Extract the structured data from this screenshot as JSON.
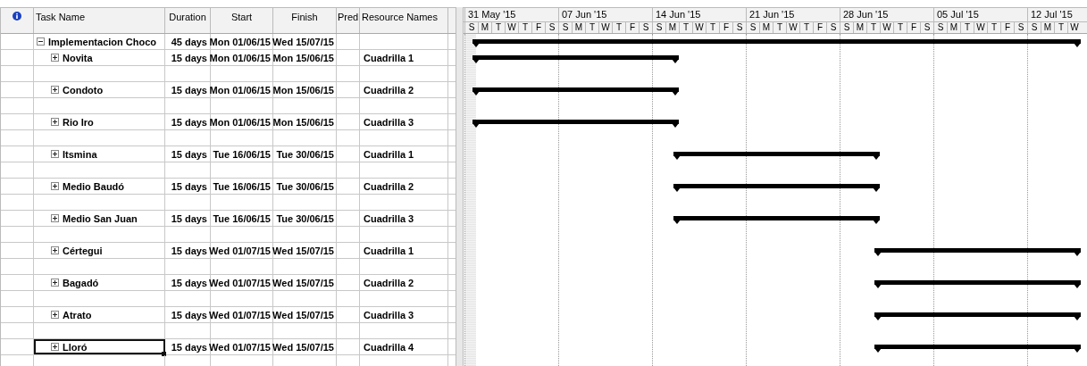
{
  "table": {
    "columns": [
      "Task Name",
      "Duration",
      "Start",
      "Finish",
      "Pred",
      "Resource Names"
    ],
    "summary": {
      "name": "Implementacion Choco",
      "duration": "45 days",
      "start": "Mon 01/06/15",
      "finish": "Wed 15/07/15",
      "expanded": true,
      "selected": false,
      "children": [
        {
          "name": "Novita",
          "duration": "15 days",
          "start": "Mon 01/06/15",
          "finish": "Mon 15/06/15",
          "resource": "Cuadrilla 1",
          "expanded": false,
          "selected": false
        },
        {
          "name": "Condoto",
          "duration": "15 days",
          "start": "Mon 01/06/15",
          "finish": "Mon 15/06/15",
          "resource": "Cuadrilla 2",
          "expanded": false,
          "selected": false
        },
        {
          "name": "Rio Iro",
          "duration": "15 days",
          "start": "Mon 01/06/15",
          "finish": "Mon 15/06/15",
          "resource": "Cuadrilla 3",
          "expanded": false,
          "selected": false
        },
        {
          "name": "Itsmina",
          "duration": "15 days",
          "start": "Tue 16/06/15",
          "finish": "Tue 30/06/15",
          "resource": "Cuadrilla 1",
          "expanded": false,
          "selected": false
        },
        {
          "name": "Medio Baudó",
          "duration": "15 days",
          "start": "Tue 16/06/15",
          "finish": "Tue 30/06/15",
          "resource": "Cuadrilla 2",
          "expanded": false,
          "selected": false
        },
        {
          "name": "Medio San Juan",
          "duration": "15 days",
          "start": "Tue 16/06/15",
          "finish": "Tue 30/06/15",
          "resource": "Cuadrilla 3",
          "expanded": false,
          "selected": false
        },
        {
          "name": "Cértegui",
          "duration": "15 days",
          "start": "Wed 01/07/15",
          "finish": "Wed 15/07/15",
          "resource": "Cuadrilla 1",
          "expanded": false,
          "selected": false
        },
        {
          "name": "Bagadó",
          "duration": "15 days",
          "start": "Wed 01/07/15",
          "finish": "Wed 15/07/15",
          "resource": "Cuadrilla 2",
          "expanded": false,
          "selected": false
        },
        {
          "name": "Atrato",
          "duration": "15 days",
          "start": "Wed 01/07/15",
          "finish": "Wed 15/07/15",
          "resource": "Cuadrilla 3",
          "expanded": false,
          "selected": false
        },
        {
          "name": "Lloró",
          "duration": "15 days",
          "start": "Wed 01/07/15",
          "finish": "Wed 15/07/15",
          "resource": "Cuadrilla 4",
          "expanded": false,
          "selected": true
        }
      ]
    }
  },
  "timeline": {
    "weeks": [
      "31 May '15",
      "07 Jun '15",
      "14 Jun '15",
      "21 Jun '15",
      "28 Jun '15",
      "05 Jul '15",
      "12 Jul '15"
    ],
    "days": [
      "S",
      "M",
      "T",
      "W",
      "T",
      "F",
      "S",
      "S",
      "M",
      "T",
      "W",
      "T",
      "F",
      "S",
      "S",
      "M",
      "T",
      "W",
      "T",
      "F",
      "S",
      "S",
      "M",
      "T",
      "W",
      "T",
      "F",
      "S",
      "S",
      "M",
      "T",
      "W",
      "T",
      "F",
      "S",
      "S",
      "M",
      "T",
      "W",
      "T",
      "F",
      "S",
      "S",
      "M",
      "T",
      "W"
    ]
  }
}
